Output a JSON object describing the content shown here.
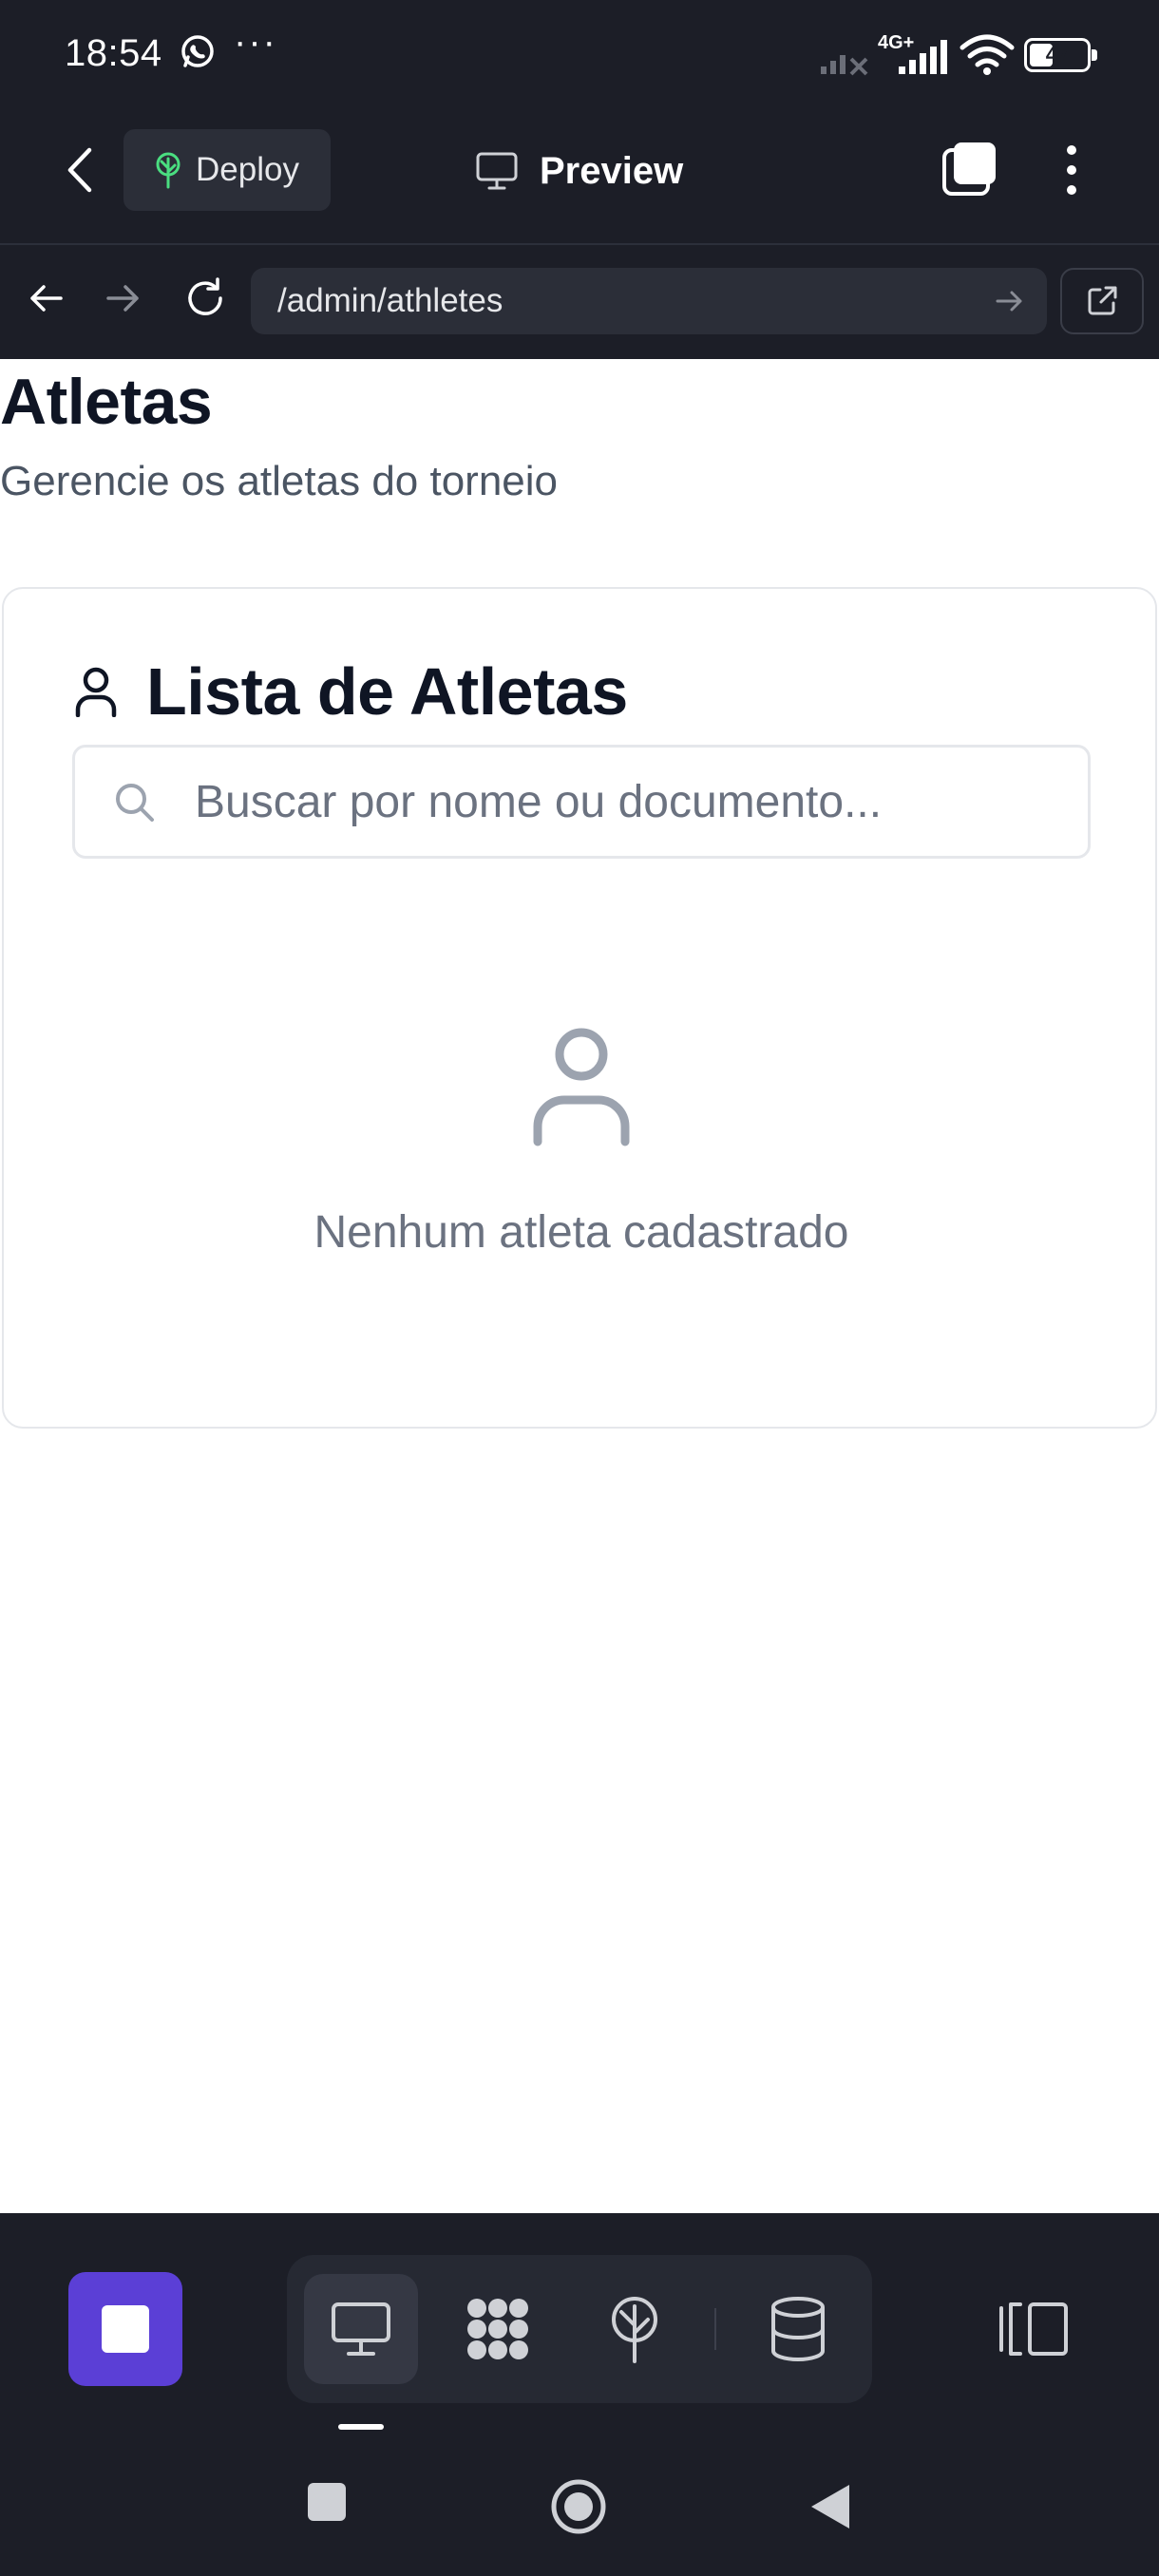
{
  "status_bar": {
    "time": "18:54",
    "battery": "47",
    "battery_level": 0.47,
    "network": "4G+"
  },
  "toolbar": {
    "deploy_label": "Deploy",
    "preview_label": "Preview"
  },
  "browser": {
    "url": "/admin/athletes"
  },
  "page": {
    "title": "Atletas",
    "subtitle": "Gerencie os atletas do torneio"
  },
  "athletes_card": {
    "title": "Lista de Atletas",
    "search_placeholder": "Buscar por nome ou documento...",
    "search_value": "",
    "empty_message": "Nenhum atleta cadastrado"
  },
  "colors": {
    "chrome_bg": "#1c1e27",
    "accent": "#5b3fd6",
    "deploy_icon": "#4ade80",
    "muted_icon": "#9ca3af"
  },
  "icons": {
    "status": [
      "whatsapp-icon",
      "more-dots-icon",
      "signal-icon",
      "wifi-icon",
      "battery-icon"
    ],
    "toolbar": [
      "back-chevron-icon",
      "deploy-tree-icon",
      "monitor-icon",
      "tabs-icon",
      "kebab-icon"
    ],
    "bottom": [
      "stop-icon",
      "monitor-icon",
      "grid-dots-icon",
      "deploy-tree-icon",
      "database-icon",
      "panel-toggle-icon"
    ]
  }
}
